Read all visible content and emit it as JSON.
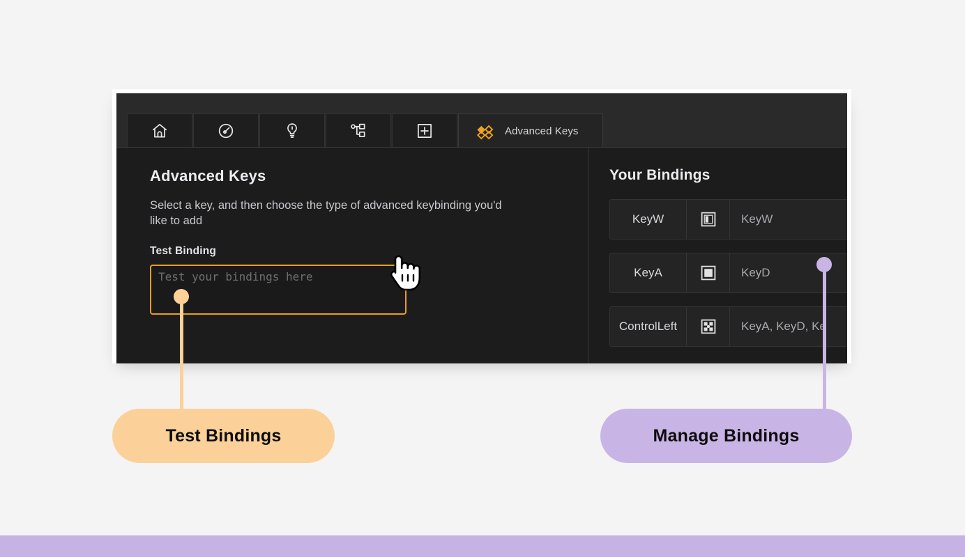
{
  "window": {
    "tabs": [
      {
        "name": "home",
        "icon": "home-icon",
        "label": ""
      },
      {
        "name": "gauge",
        "icon": "gauge-icon",
        "label": ""
      },
      {
        "name": "lighting",
        "icon": "lightbulb-icon",
        "label": ""
      },
      {
        "name": "macros",
        "icon": "node-tree-icon",
        "label": ""
      },
      {
        "name": "add",
        "icon": "plus-box-icon",
        "label": ""
      }
    ],
    "active_tab": {
      "icon": "diamond-cluster-icon",
      "label": "Advanced Keys",
      "icon_color": "#f0a21e"
    }
  },
  "left_pane": {
    "title": "Advanced Keys",
    "description": "Select a key, and then choose the type of advanced keybinding you'd like to add",
    "field_label": "Test Binding",
    "input_value": "",
    "input_placeholder": "Test your bindings here",
    "input_border_color": "#e99e1f"
  },
  "right_pane": {
    "title": "Your Bindings",
    "rows": [
      {
        "key": "KeyW",
        "icon": "half-filled-square-icon",
        "output": "KeyW"
      },
      {
        "key": "KeyA",
        "icon": "filled-square-icon",
        "output": "KeyD"
      },
      {
        "key": "ControlLeft",
        "icon": "dot-grid-square-icon",
        "output": "KeyA, KeyD, Ke"
      }
    ]
  },
  "callouts": [
    {
      "label": "Test Bindings",
      "color": "#fbd199"
    },
    {
      "label": "Manage Bindings",
      "color": "#c9b4e6"
    }
  ],
  "cursor": {
    "type": "pointing-hand-cursor"
  },
  "bottom_bar": {
    "color": "#c6b3e3"
  }
}
